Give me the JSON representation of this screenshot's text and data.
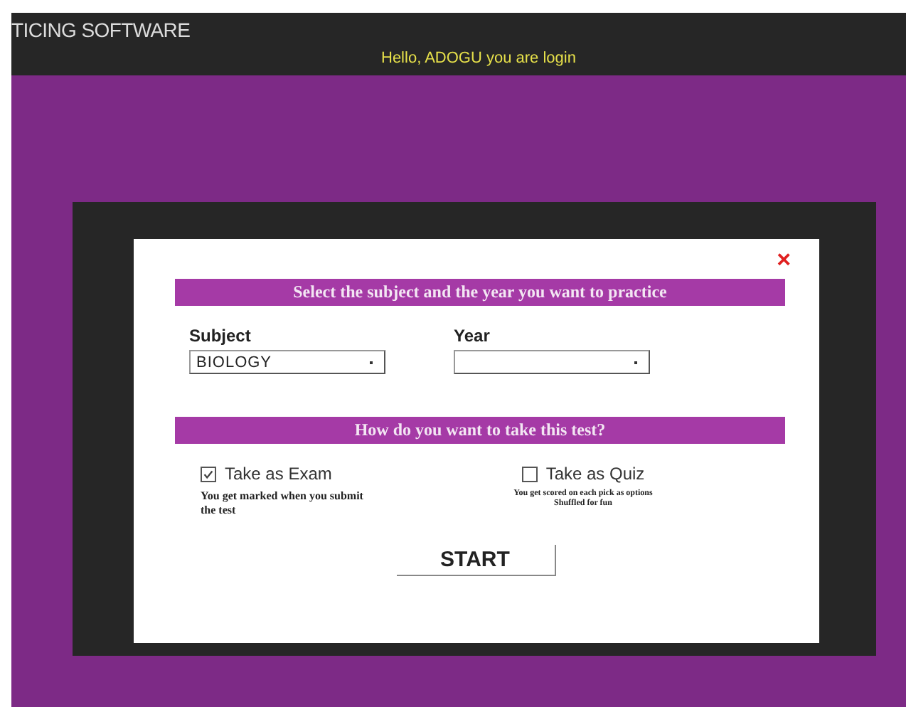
{
  "header": {
    "title": "TICING SOFTWARE",
    "greeting": "Hello, ADOGU you are login"
  },
  "dialog": {
    "close": "×",
    "subject_heading": "Select the subject and the year you want to practice",
    "fields": [
      {
        "label": "Subject",
        "value": "BIOLOGY"
      },
      {
        "label": "Year"
      }
    ],
    "mode_heading": "How do you want to take this test?",
    "modes": [
      {
        "label": "Take as Exam",
        "checked": true,
        "note": "You get marked when you submit the test"
      },
      {
        "label": "Take as Quiz",
        "checked": false,
        "note": "You get scored on each pick as options Shuffled for fun"
      }
    ],
    "start": "START"
  }
}
